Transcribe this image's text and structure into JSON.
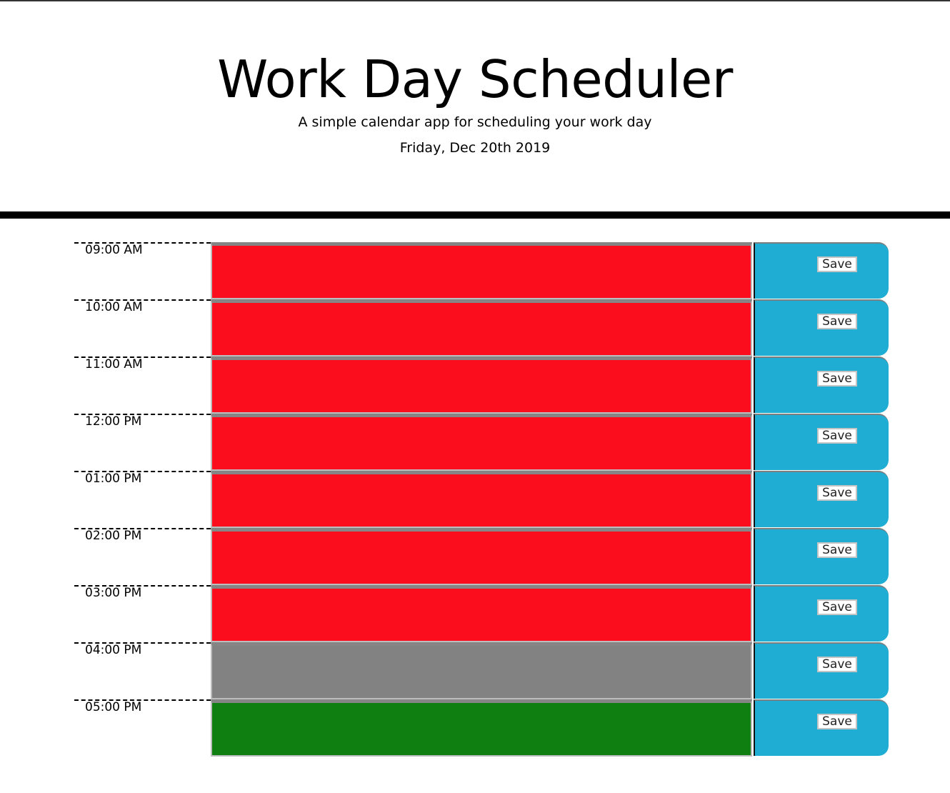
{
  "header": {
    "title": "Work Day Scheduler",
    "subtitle": "A simple calendar app for scheduling your work day",
    "current_date": "Friday, Dec 20th 2019"
  },
  "colors": {
    "past": "#fc0d1e",
    "present": "#828282",
    "future": "#107f12",
    "save": "#1fadd3"
  },
  "rows": [
    {
      "hour": "09:00 AM",
      "state": "past",
      "text": "",
      "save_label": "Save"
    },
    {
      "hour": "10:00 AM",
      "state": "past",
      "text": "",
      "save_label": "Save"
    },
    {
      "hour": "11:00 AM",
      "state": "past",
      "text": "",
      "save_label": "Save"
    },
    {
      "hour": "12:00 PM",
      "state": "past",
      "text": "",
      "save_label": "Save"
    },
    {
      "hour": "01:00 PM",
      "state": "past",
      "text": "",
      "save_label": "Save"
    },
    {
      "hour": "02:00 PM",
      "state": "past",
      "text": "",
      "save_label": "Save"
    },
    {
      "hour": "03:00 PM",
      "state": "past",
      "text": "",
      "save_label": "Save"
    },
    {
      "hour": "04:00 PM",
      "state": "present",
      "text": "",
      "save_label": "Save"
    },
    {
      "hour": "05:00 PM",
      "state": "future",
      "text": "",
      "save_label": "Save"
    }
  ]
}
